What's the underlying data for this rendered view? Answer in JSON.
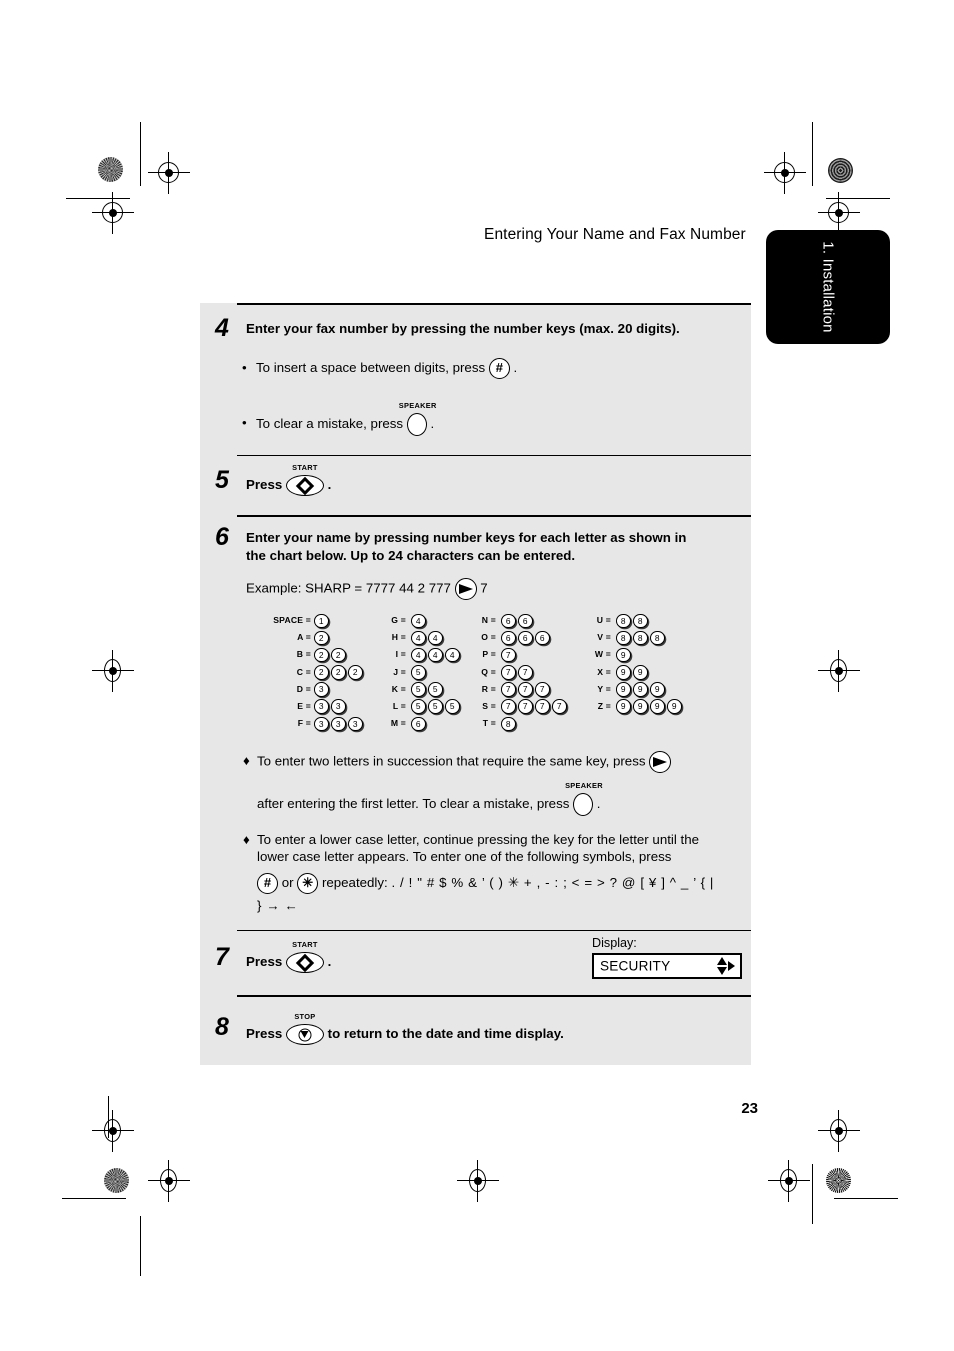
{
  "header": {
    "title": "Entering Your Name and Fax Number",
    "chapter_tab": "1. Installation",
    "page_number": "23"
  },
  "steps": [
    {
      "number": "4",
      "title": "Enter your fax number by pressing the number keys (max. 20 digits).",
      "bullets": [
        {
          "marker": "•",
          "before": "To insert a space between digits, press",
          "key": "#",
          "after": "."
        },
        {
          "marker": "•",
          "before": "To clear a mistake, press",
          "key": "SPEAKER",
          "after": "."
        }
      ]
    },
    {
      "number": "5",
      "press_label": "Press",
      "key": "START",
      "after": "."
    },
    {
      "number": "6",
      "title_line1": "Enter your name by pressing number keys for each letter as shown in",
      "title_line2": "the chart below. Up to 24 characters can be entered.",
      "example_before": "Example: SHARP = 7777  44  2  777",
      "example_key": "arrow-right",
      "example_after": "7",
      "notes": [
        {
          "marker": "♦",
          "line1_before": "To enter two letters in succession that require the same key, press",
          "line1_key": "arrow-right",
          "line2_before": "after entering the first letter. To clear a mistake, press",
          "line2_key": "SPEAKER",
          "line2_after": "."
        },
        {
          "marker": "♦",
          "line1": "To enter a lower case letter, continue pressing the key for the letter until the",
          "line2": "lower case letter appears. To enter one of the following symbols, press",
          "key_a": "#",
          "or_text": "or",
          "key_b": "✳",
          "line3_before": "repeatedly:",
          "symbols_line1": ". / ! \" # $ % & ’ ( ) ✳ + , - : ; < = > ? @ [ ¥ ] ^ _ ’ { |",
          "symbols_line2": "} → ←"
        }
      ]
    },
    {
      "number": "7",
      "press_label": "Press",
      "key": "START",
      "after": ".",
      "display_label": "Display:",
      "display_value": "SECURITY"
    },
    {
      "number": "8",
      "press_label": "Press",
      "key": "STOP",
      "after": "to return to the date and time display."
    }
  ],
  "letter_chart": {
    "columns": [
      {
        "rows": [
          {
            "letter": "SPACE",
            "digits": [
              "1"
            ]
          },
          {
            "letter": "A",
            "digits": [
              "2"
            ]
          },
          {
            "letter": "B",
            "digits": [
              "2",
              "2"
            ]
          },
          {
            "letter": "C",
            "digits": [
              "2",
              "2",
              "2"
            ]
          },
          {
            "letter": "D",
            "digits": [
              "3"
            ]
          },
          {
            "letter": "E",
            "digits": [
              "3",
              "3"
            ]
          },
          {
            "letter": "F",
            "digits": [
              "3",
              "3",
              "3"
            ]
          }
        ]
      },
      {
        "rows": [
          {
            "letter": "G",
            "digits": [
              "4"
            ]
          },
          {
            "letter": "H",
            "digits": [
              "4",
              "4"
            ]
          },
          {
            "letter": "I",
            "digits": [
              "4",
              "4",
              "4"
            ]
          },
          {
            "letter": "J",
            "digits": [
              "5"
            ]
          },
          {
            "letter": "K",
            "digits": [
              "5",
              "5"
            ]
          },
          {
            "letter": "L",
            "digits": [
              "5",
              "5",
              "5"
            ]
          },
          {
            "letter": "M",
            "digits": [
              "6"
            ]
          }
        ]
      },
      {
        "rows": [
          {
            "letter": "N",
            "digits": [
              "6",
              "6"
            ]
          },
          {
            "letter": "O",
            "digits": [
              "6",
              "6",
              "6"
            ]
          },
          {
            "letter": "P",
            "digits": [
              "7"
            ]
          },
          {
            "letter": "Q",
            "digits": [
              "7",
              "7"
            ]
          },
          {
            "letter": "R",
            "digits": [
              "7",
              "7",
              "7"
            ]
          },
          {
            "letter": "S",
            "digits": [
              "7",
              "7",
              "7",
              "7"
            ]
          },
          {
            "letter": "T",
            "digits": [
              "8"
            ]
          }
        ]
      },
      {
        "rows": [
          {
            "letter": "U",
            "digits": [
              "8",
              "8"
            ]
          },
          {
            "letter": "V",
            "digits": [
              "8",
              "8",
              "8"
            ]
          },
          {
            "letter": "W",
            "digits": [
              "9"
            ]
          },
          {
            "letter": "X",
            "digits": [
              "9",
              "9"
            ]
          },
          {
            "letter": "Y",
            "digits": [
              "9",
              "9",
              "9"
            ]
          },
          {
            "letter": "Z",
            "digits": [
              "9",
              "9",
              "9",
              "9"
            ]
          }
        ]
      }
    ]
  },
  "colors": {
    "panel_bg": "#e7e7e7",
    "tab_bg": "#000000",
    "page_bg": "#ffffff"
  }
}
